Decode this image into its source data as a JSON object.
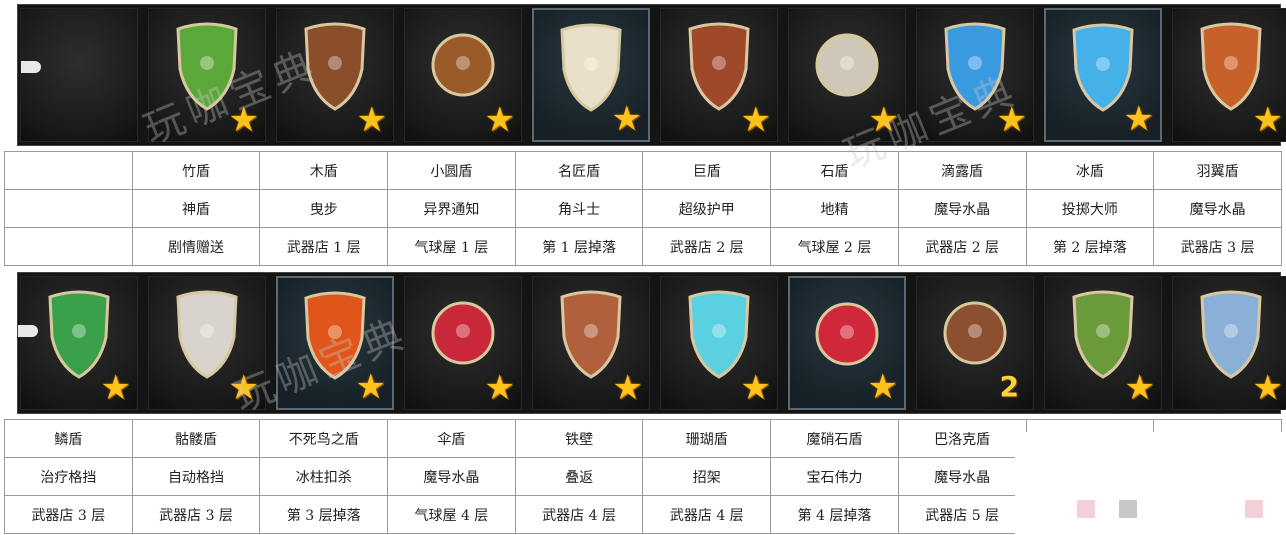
{
  "watermark": {
    "text": "玩咖宝典"
  },
  "top_row": {
    "shields": [
      {
        "icon": "pointer-tile",
        "name": "",
        "skill": "",
        "source": ""
      },
      {
        "icon": "bamboo-shield-icon",
        "color": "#5aa83a",
        "name": "竹盾",
        "skill": "神盾",
        "source": "剧情赠送"
      },
      {
        "icon": "wooden-shield-icon",
        "color": "#8a4e2a",
        "name": "木盾",
        "skill": "曳步",
        "source": "武器店 1 层"
      },
      {
        "icon": "small-round-shield-icon",
        "color": "#9a5a2a",
        "name": "小圆盾",
        "skill": "异界通知",
        "source": "气球屋 1 层"
      },
      {
        "icon": "master-shield-icon",
        "color": "#e8e0c8",
        "name": "名匠盾",
        "skill": "角斗士",
        "source": "第 1 层掉落"
      },
      {
        "icon": "giant-shield-icon",
        "color": "#a0482a",
        "name": "巨盾",
        "skill": "超级护甲",
        "source": "武器店 2 层"
      },
      {
        "icon": "stone-shield-icon",
        "color": "#cfc8b8",
        "name": "石盾",
        "skill": "地精",
        "source": "气球屋 2 层"
      },
      {
        "icon": "dewdrop-shield-icon",
        "color": "#3a9ae0",
        "name": "滴露盾",
        "skill": "魔导水晶",
        "source": "武器店 2 层"
      },
      {
        "icon": "ice-shield-icon",
        "color": "#46b0e8",
        "name": "冰盾",
        "skill": "投掷大师",
        "source": "第 2 层掉落"
      },
      {
        "icon": "feather-shield-icon",
        "color": "#c8602a",
        "name": "羽翼盾",
        "skill": "魔导水晶",
        "source": "武器店 3 层"
      }
    ]
  },
  "bottom_row": {
    "shields": [
      {
        "icon": "scale-shield-icon",
        "color": "#3aa04a",
        "name": "鳞盾",
        "skill": "治疗格挡",
        "source": "武器店 3 层"
      },
      {
        "icon": "skull-shield-icon",
        "color": "#d8d4cc",
        "name": "骷髅盾",
        "skill": "自动格挡",
        "source": "武器店 3 层"
      },
      {
        "icon": "phoenix-shield-icon",
        "color": "#e0561a",
        "name": "不死鸟之盾",
        "skill": "冰柱扣杀",
        "source": "第 3 层掉落"
      },
      {
        "icon": "umbrella-shield-icon",
        "color": "#c8283a",
        "name": "伞盾",
        "skill": "魔导水晶",
        "source": "气球屋 4 层"
      },
      {
        "icon": "iron-wall-shield-icon",
        "color": "#b0603a",
        "name": "铁壁",
        "skill": "叠返",
        "source": "武器店 4 层"
      },
      {
        "icon": "coral-shield-icon",
        "color": "#5ad0e0",
        "name": "珊瑚盾",
        "skill": "招架",
        "source": "武器店 4 层"
      },
      {
        "icon": "magic-stone-shield-icon",
        "color": "#d0283a",
        "name": "魔硝石盾",
        "skill": "宝石伟力",
        "source": "第 4 层掉落"
      },
      {
        "icon": "barok-shield-icon",
        "color": "#8a5030",
        "name": "巴洛克盾",
        "skill": "魔导水晶",
        "source": "武器店 5 层",
        "badge": "2"
      },
      {
        "icon": "turtle-shield-icon",
        "color": "#6a9a3a",
        "name": "",
        "skill": "",
        "source": ""
      },
      {
        "icon": "holy-shield-icon",
        "color": "#8ab0d8",
        "name": "",
        "skill": "",
        "source": ""
      }
    ]
  },
  "table_headers": {
    "empty": ""
  },
  "colors": {
    "star": "#ffc21a",
    "background": "#141414",
    "grid": "#9a9a9a"
  }
}
